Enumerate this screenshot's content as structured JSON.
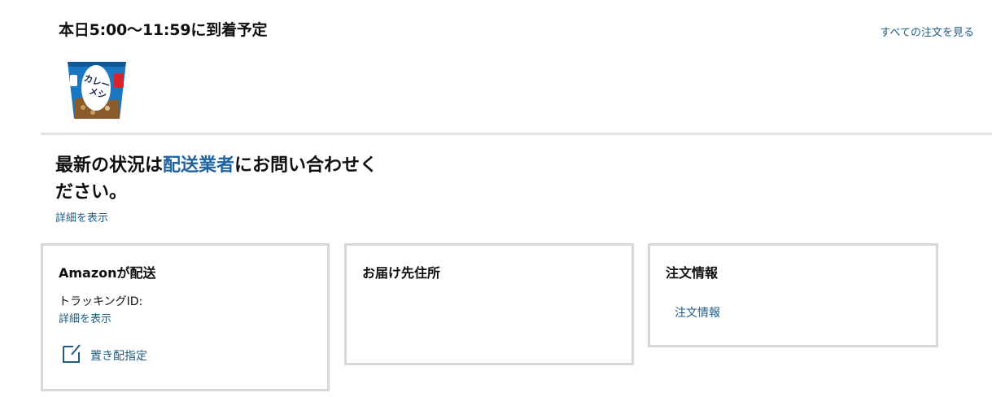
{
  "header": {
    "arrival_title": "本日5:00～11:59に到着予定",
    "all_orders_link": "すべての注文を見る"
  },
  "product": {
    "image_label": "カレーメシ"
  },
  "status": {
    "headline_before": "最新の状況は",
    "headline_carrier": "配送業者",
    "headline_after": "にお問い合わせく",
    "headline_line2": "ださい。",
    "details_link": "詳細を表示"
  },
  "cards": {
    "shipping": {
      "title": "Amazonが配送",
      "tracking_label": "トラッキングID:",
      "details_link": "詳細を表示",
      "drop_off_label": "置き配指定",
      "drop_off_icon": "edit-note-icon"
    },
    "address": {
      "title": "お届け先住所"
    },
    "order": {
      "title": "注文情報",
      "link": "注文情報"
    }
  },
  "colors": {
    "link": "#1f5c80",
    "carrier_accent": "#2162a1",
    "border": "#d5d9d9"
  }
}
